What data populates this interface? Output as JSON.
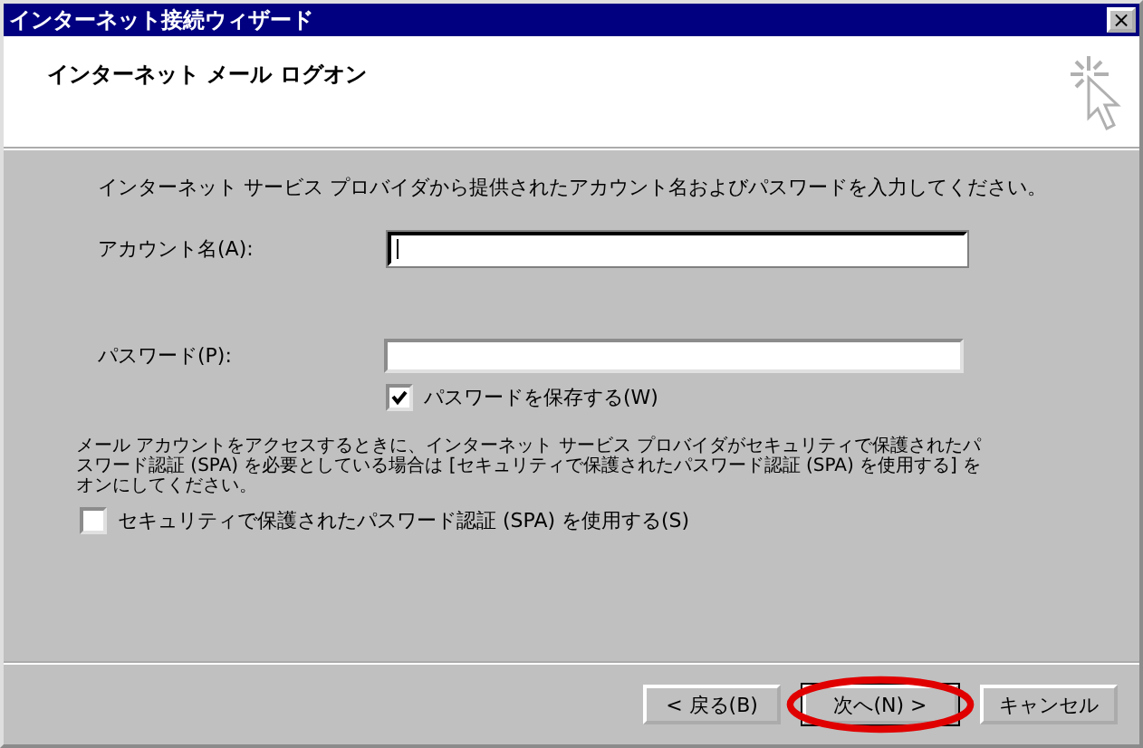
{
  "window": {
    "title": "インターネット接続ウィザード",
    "close": "×"
  },
  "header": {
    "title": "インターネット メール ログオン"
  },
  "intro": "インターネット サービス プロバイダから提供されたアカウント名およびパスワードを入力してください。",
  "fields": [
    {
      "label": "アカウント名(A):",
      "focused": true
    },
    {
      "label": "パスワード(P):",
      "focused": false
    }
  ],
  "save_password": {
    "label": "パスワードを保存する(W)",
    "checked": true
  },
  "spa_note": "メール アカウントをアクセスするときに、インターネット サービス プロバイダがセキュリティで保護されたパスワード認証 (SPA) を必要としている場合は [セキュリティで保護されたパスワード認証 (SPA) を使用する] をオンにしてください。",
  "spa": {
    "label": "セキュリティで保護されたパスワード認証 (SPA) を使用する(S)",
    "checked": false
  },
  "buttons": [
    {
      "label": "< 戻る(B)",
      "default": false,
      "circled": false
    },
    {
      "label": "次へ(N) >",
      "default": true,
      "circled": true
    },
    {
      "label": "キャンセル",
      "default": false,
      "circled": false
    }
  ]
}
